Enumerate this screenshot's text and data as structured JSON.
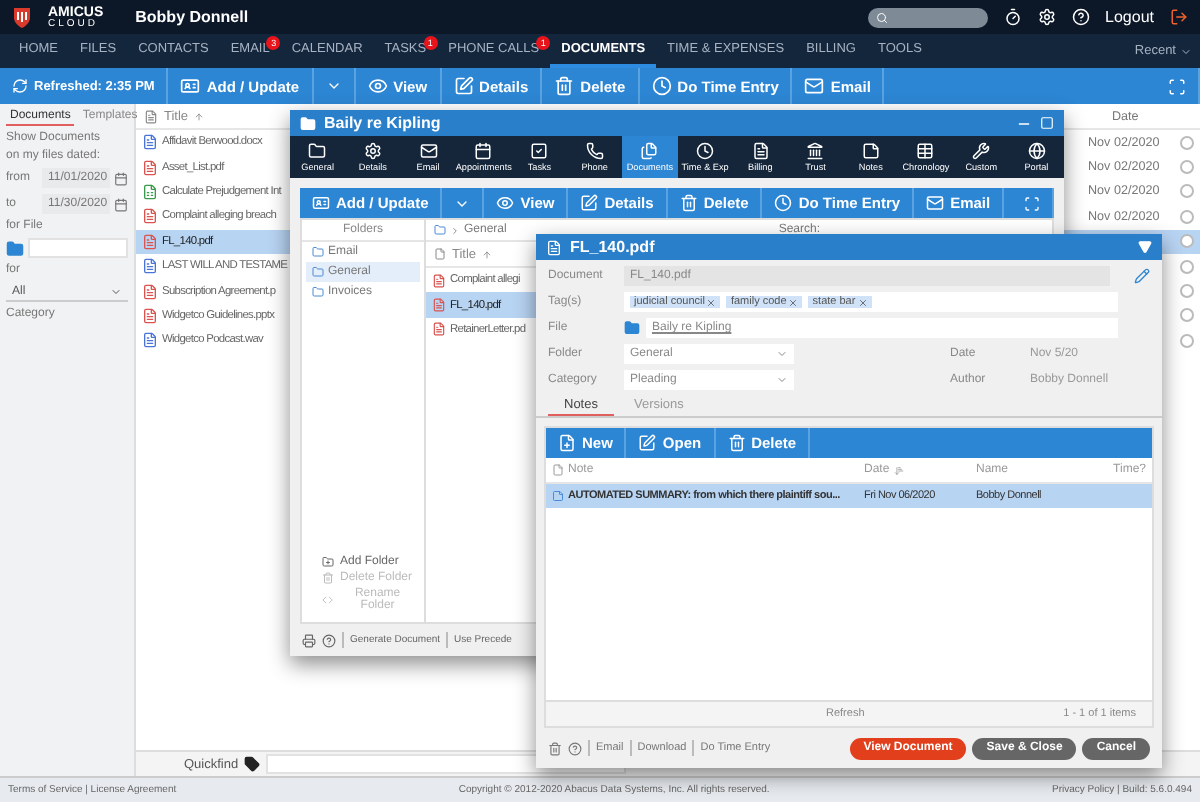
{
  "header": {
    "brand": "AMICUS",
    "brand_sub": "CLOUD",
    "user": "Bobby Donnell",
    "logout": "Logout"
  },
  "nav": [
    {
      "label": "HOME",
      "selected": false
    },
    {
      "label": "FILES",
      "selected": false
    },
    {
      "label": "CONTACTS",
      "selected": false
    },
    {
      "label": "EMAIL",
      "selected": false,
      "badge": "3"
    },
    {
      "label": "CALENDAR",
      "selected": false
    },
    {
      "label": "TASKS",
      "selected": false,
      "badge": "1"
    },
    {
      "label": "PHONE CALLS",
      "selected": false,
      "badge": "1"
    },
    {
      "label": "DOCUMENTS",
      "selected": true
    },
    {
      "label": "TIME & EXPENSES",
      "selected": false
    },
    {
      "label": "BILLING",
      "selected": false
    },
    {
      "label": "TOOLS",
      "selected": false
    }
  ],
  "nav_right": "Recent",
  "toolbar": {
    "refreshed": "Refreshed: 2:35 PM",
    "buttons": [
      {
        "kind": "add",
        "label": "Add / Update"
      },
      {
        "kind": "view",
        "label": "View"
      },
      {
        "kind": "details",
        "label": "Details"
      },
      {
        "kind": "delete",
        "label": "Delete"
      },
      {
        "kind": "time",
        "label": "Do Time Entry"
      },
      {
        "kind": "email",
        "label": "Email"
      }
    ]
  },
  "sidebar": {
    "tabs": [
      {
        "label": "Documents",
        "selected": true
      },
      {
        "label": "Templates",
        "selected": false
      }
    ],
    "show_label": "Show Documents",
    "dated_label": "on my files dated:",
    "from_label": "from",
    "from_value": "11/01/2020",
    "to_label": "to",
    "to_value": "11/30/2020",
    "file_label": "for File",
    "for_label": "for",
    "for_value": "All",
    "category_label": "Category"
  },
  "list": {
    "title_header": "Title",
    "date_header": "Date",
    "rows": [
      {
        "title": "Affidavit Berwood.docx",
        "kind": "doc",
        "selected": false,
        "checked": false,
        "date": "Nov 02/2020"
      },
      {
        "title": "Asset_List.pdf",
        "kind": "pdf",
        "selected": false,
        "checked": false,
        "date": "Nov 02/2020"
      },
      {
        "title": "Calculate Prejudgement Int",
        "kind": "xls",
        "selected": false,
        "checked": false,
        "date": "Nov 02/2020"
      },
      {
        "title": "Complaint alleging breach",
        "kind": "pdf",
        "selected": false,
        "checked": false,
        "date": "Nov 02/2020"
      },
      {
        "title": "FL_140.pdf",
        "kind": "pdf",
        "selected": true,
        "checked": false
      },
      {
        "title": "LAST WILL AND TESTAME",
        "kind": "doc",
        "selected": false,
        "checked": false
      },
      {
        "title": "Subscription Agreement.p",
        "kind": "pdf",
        "selected": false,
        "checked": false
      },
      {
        "title": "Widgetco Guidelines.pptx",
        "kind": "pdf",
        "selected": false,
        "checked": false
      },
      {
        "title": "Widgetco Podcast.wav",
        "kind": "doc",
        "selected": false,
        "checked": false
      }
    ],
    "quickfind": "Quickfind"
  },
  "file_window": {
    "title": "Baily re Kipling",
    "tabs": [
      {
        "kind": "folder",
        "label": "General",
        "selected": false
      },
      {
        "kind": "gear",
        "label": "Details",
        "selected": false
      },
      {
        "kind": "mail",
        "label": "Email",
        "selected": false
      },
      {
        "kind": "calendar",
        "label": "Appointments",
        "selected": false
      },
      {
        "kind": "check",
        "label": "Tasks",
        "selected": false
      },
      {
        "kind": "phone",
        "label": "Phone",
        "selected": false
      },
      {
        "kind": "docs",
        "label": "Documents",
        "selected": true
      },
      {
        "kind": "clock",
        "label": "Time & Exp",
        "selected": false
      },
      {
        "kind": "bill",
        "label": "Billing",
        "selected": false
      },
      {
        "kind": "bank",
        "label": "Trust",
        "selected": false
      },
      {
        "kind": "note",
        "label": "Notes",
        "selected": false
      },
      {
        "kind": "table",
        "label": "Chronology",
        "selected": false
      },
      {
        "kind": "custom",
        "label": "Custom",
        "selected": false
      },
      {
        "kind": "portal",
        "label": "Portal",
        "selected": false
      }
    ],
    "buttons": [
      {
        "kind": "add",
        "label": "Add / Update"
      },
      {
        "kind": "view",
        "label": "View"
      },
      {
        "kind": "details",
        "label": "Details"
      },
      {
        "kind": "delete",
        "label": "Delete"
      },
      {
        "kind": "time",
        "label": "Do Time Entry"
      },
      {
        "kind": "email",
        "label": "Email"
      }
    ],
    "folders_header": "Folders",
    "folders": [
      {
        "name": "Email",
        "selected": false
      },
      {
        "name": "General",
        "selected": true
      },
      {
        "name": "Invoices",
        "selected": false
      }
    ],
    "folder_actions": [
      {
        "kind": "add",
        "label": "Add Folder",
        "disabled": false
      },
      {
        "kind": "delete",
        "label": "Delete Folder",
        "disabled": true
      },
      {
        "kind": "rename",
        "label": "Rename Folder",
        "disabled": true
      }
    ],
    "breadcrumb": "General",
    "search_label": "Search:",
    "title_header": "Title",
    "rows": [
      {
        "title": "Complaint allegi",
        "selected": false
      },
      {
        "title": "FL_140.pdf",
        "selected": true
      },
      {
        "title": "RetainerLetter.pd",
        "selected": false
      }
    ],
    "footer_links": [
      "Generate Document",
      "Use Precede"
    ]
  },
  "doc_dialog": {
    "title": "FL_140.pdf",
    "document_label": "Document",
    "document_value": "FL_140.pdf",
    "tags_label": "Tag(s)",
    "tags": [
      "judicial council",
      "family code",
      "state bar"
    ],
    "file_label": "File",
    "file_value": "Baily re Kipling",
    "folder_label": "Folder",
    "folder_value": "General",
    "category_label": "Category",
    "category_value": "Pleading",
    "date_label": "Date",
    "date_value": "Nov 5/20",
    "author_label": "Author",
    "author_value": "Bobby Donnell",
    "tabs": [
      {
        "label": "Notes",
        "selected": true
      },
      {
        "label": "Versions",
        "selected": false
      }
    ],
    "buttons": [
      {
        "kind": "new",
        "label": "New"
      },
      {
        "kind": "open",
        "label": "Open"
      },
      {
        "kind": "delete",
        "label": "Delete"
      }
    ],
    "columns": [
      "Note",
      "Date",
      "Name",
      "Time?"
    ],
    "rows": [
      {
        "note": "AUTOMATED SUMMARY: from which there plaintiff sou...",
        "date": "Fri Nov 06/2020",
        "name": "Bobby Donnell",
        "selected": true
      }
    ],
    "refresh": "Refresh",
    "count": "1 - 1 of 1 items",
    "footer_links": [
      "Email",
      "Download",
      "Do Time Entry"
    ],
    "actions": [
      {
        "kind": "primary",
        "label": "View Document"
      },
      {
        "kind": "secondary",
        "label": "Save & Close"
      },
      {
        "kind": "secondary",
        "label": "Cancel"
      }
    ]
  },
  "footer": {
    "left": "Terms of Service | License Agreement",
    "center": "Copyright © 2012-2020 Abacus Data Systems, Inc. All rights reserved.",
    "right": "Privacy Policy | Build: 5.6.0.494"
  }
}
